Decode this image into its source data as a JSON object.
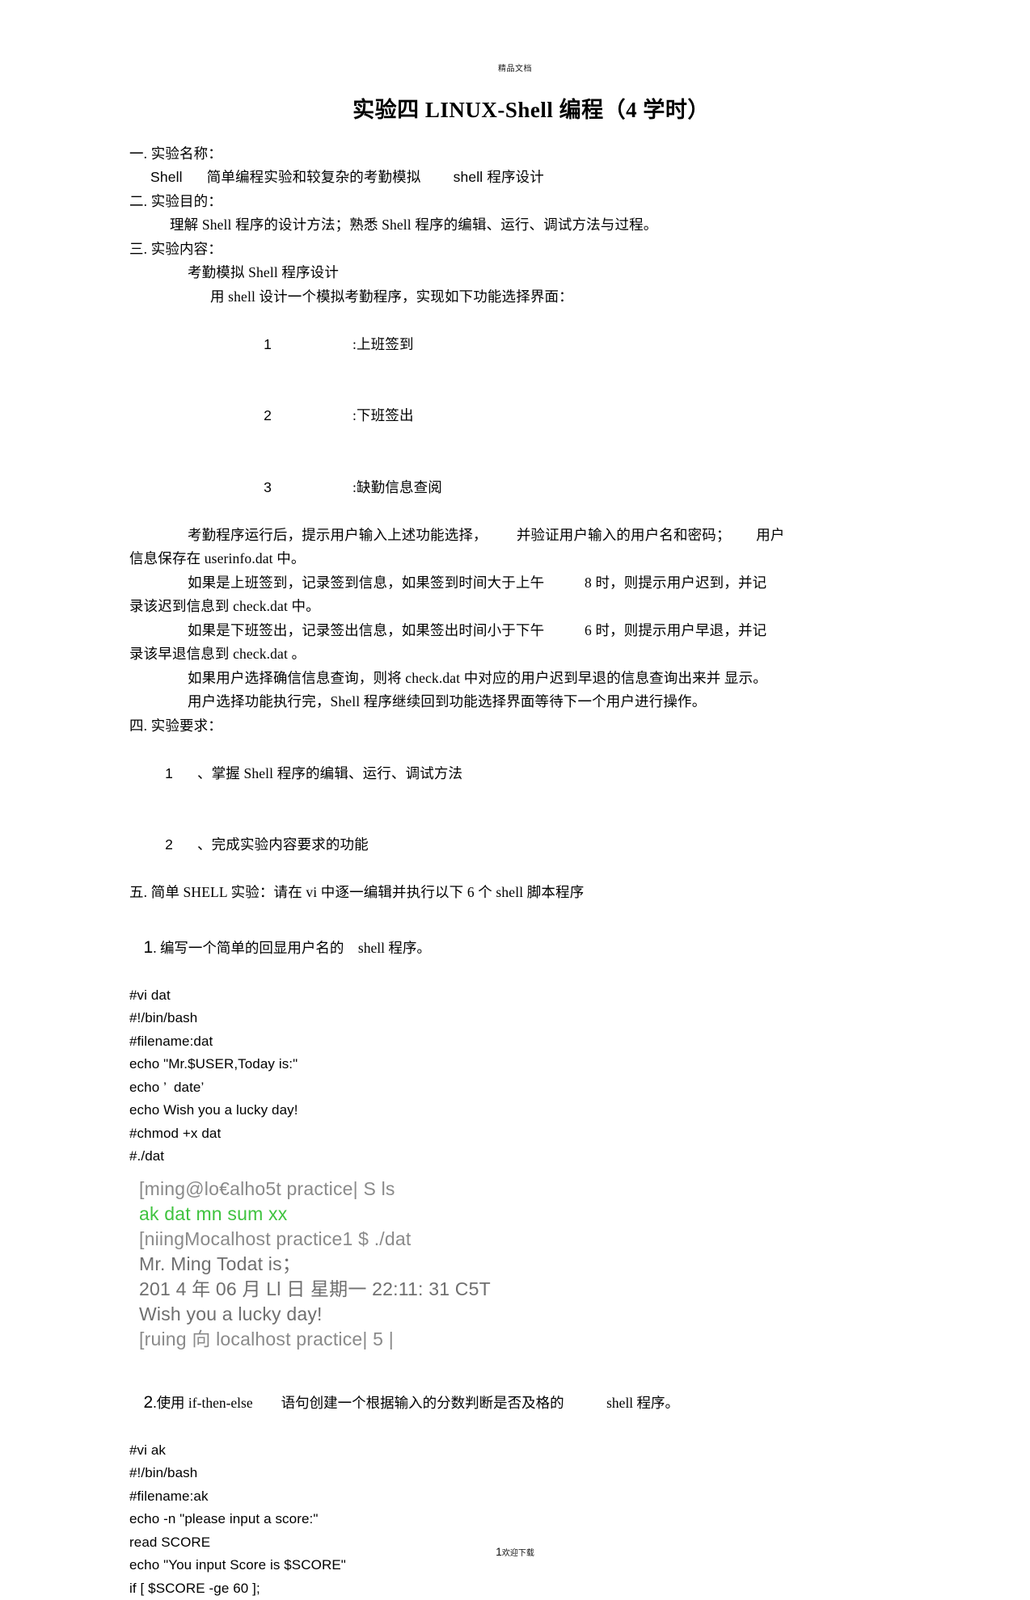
{
  "header": {
    "watermark": "精品文档"
  },
  "title": "实验四 LINUX-Shell 编程（4 学时）",
  "sections": {
    "s1_head": "一. 实验名称：",
    "s1_body": "Shell      简单编程实验和较复杂的考勤模拟        shell 程序设计",
    "s2_head": "二. 实验目的：",
    "s2_body": "理解 Shell 程序的设计方法；熟悉 Shell 程序的编辑、运行、调试方法与过程。",
    "s3_head": "三. 实验内容：",
    "s3_line1": "考勤模拟 Shell 程序设计",
    "s3_line2": "用 shell 设计一个模拟考勤程序，实现如下功能选择界面：",
    "menu": [
      {
        "num": "1",
        "label": ":上班签到"
      },
      {
        "num": "2",
        "label": ":下班签出"
      },
      {
        "num": "3",
        "label": ":缺勤信息查阅"
      }
    ],
    "s3_para1": "考勤程序运行后，提示用户输入上述功能选择，        并验证用户输入的用户名和密码；       用户",
    "s3_para1b": "信息保存在 userinfo.dat 中。",
    "s3_para2": "如果是上班签到，记录签到信息，如果签到时间大于上午           8 时，则提示用户迟到，并记",
    "s3_para2b": "录该迟到信息到 check.dat 中。",
    "s3_para3": "如果是下班签出，记录签出信息，如果签出时间小于下午           6 时，则提示用户早退，并记",
    "s3_para3b": "录该早退信息到 check.dat 。",
    "s3_para4": "如果用户选择确信信息查询，则将 check.dat 中对应的用户迟到早退的信息查询出来并 显示。",
    "s3_para5": "用户选择功能执行完，Shell 程序继续回到功能选择界面等待下一个用户进行操作。",
    "s4_head": "四. 实验要求：",
    "s4_items": [
      {
        "num": "1",
        "label": "、掌握 Shell 程序的编辑、运行、调试方法"
      },
      {
        "num": "2",
        "label": "、完成实验内容要求的功能"
      }
    ],
    "s5_head": "五. 简单 SHELL 实验：请在 vi 中逐一编辑并执行以下 6 个 shell 脚本程序"
  },
  "exercise1": {
    "num": "1",
    "text": ". 编写一个简单的回显用户名的    shell 程序。",
    "code": [
      "#vi dat",
      "#!/bin/bash",
      "#filename:dat",
      "echo \"Mr.$USER,Today is:\"",
      "echo ’  date’",
      "echo Wish you a lucky day!",
      "#chmod +x dat",
      "#./dat"
    ],
    "terminal": [
      {
        "text": "[ming@lo€alho5t practice| S ls",
        "style": "dim"
      },
      {
        "text": "ak dat mn sum xx",
        "style": "green"
      },
      {
        "text": "[niingMocalhost practice1 $ ./dat",
        "style": "dim"
      },
      {
        "text": "Mr. Ming Todat is；",
        "style": "dark"
      },
      {
        "text": "201 4 年 06 月 Ll 日 星期一 22:11: 31 C5T",
        "style": "dark"
      },
      {
        "text": "Wish you a lucky day!",
        "style": "dark"
      },
      {
        "text": "[ruing 向 localhost practice| 5 |",
        "style": "dim"
      }
    ]
  },
  "exercise2": {
    "num": "2",
    "text": ".使用 if-then-else        语句创建一个根据输入的分数判断是否及格的            shell 程序。",
    "code": [
      "#vi ak",
      "#!/bin/bash",
      "#filename:ak",
      "echo -n \"please input a score:\"",
      "read SCORE",
      "echo \"You input Score is $SCORE\"",
      "if [ $SCORE -ge 60 ];"
    ]
  },
  "footer": {
    "page_number": "1",
    "note": "欢迎下载"
  }
}
